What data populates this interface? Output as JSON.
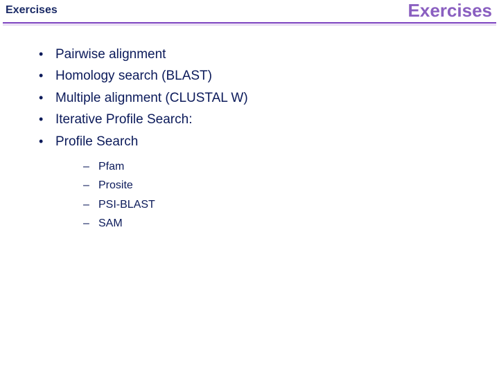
{
  "header": {
    "title_left": "Exercises",
    "title_right": "Exercises"
  },
  "bullets": {
    "b0": "Pairwise alignment",
    "b1": "Homology search (BLAST)",
    "b2": "Multiple alignment (CLUSTAL W)",
    "b3": "Iterative Profile Search:",
    "b4": "Profile Search"
  },
  "sub_bullets": {
    "s0": "Pfam",
    "s1": "Prosite",
    "s2": "PSI-BLAST",
    "s3": "SAM"
  }
}
